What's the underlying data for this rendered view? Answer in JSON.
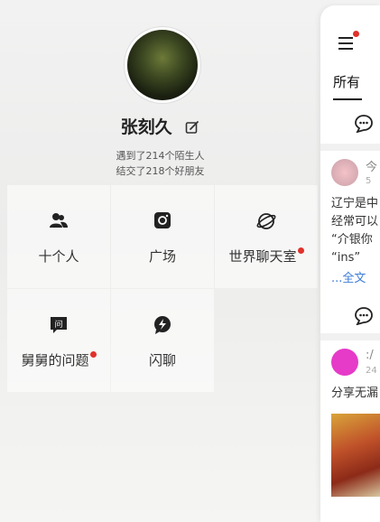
{
  "profile": {
    "name": "张刻久",
    "met_strangers": "遇到了214个陌生人",
    "friends_made": "结交了218个好朋友"
  },
  "menu": [
    {
      "label": "十个人",
      "icon": "users-icon",
      "badge": false
    },
    {
      "label": "广场",
      "icon": "camera-icon",
      "badge": false
    },
    {
      "label": "世界聊天室",
      "icon": "planet-icon",
      "badge": true
    },
    {
      "label": "舅舅的问题",
      "icon": "question-chat-icon",
      "badge": true
    },
    {
      "label": "闪聊",
      "icon": "lightning-chat-icon",
      "badge": false
    }
  ],
  "feed": {
    "tab_all": "所有",
    "post1": {
      "time": "今",
      "date": "5",
      "lines": [
        "辽宁是中",
        "经常可以",
        "“介银你",
        "“ins”"
      ],
      "more": "...全文"
    },
    "post2": {
      "user": ":/",
      "date": "24",
      "text": "分享无漏"
    }
  },
  "colors": {
    "badge": "#e0322a",
    "link": "#3b7cd8",
    "post2_avatar": "#e63ac8"
  }
}
